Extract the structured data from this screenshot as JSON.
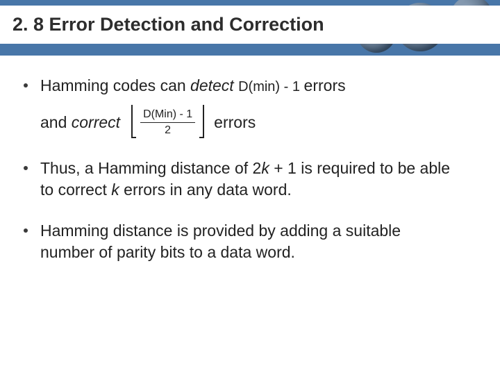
{
  "title": "2. 8 Error Detection and Correction",
  "bullets": {
    "b1": {
      "pre": "Hamming codes can ",
      "detect": "detect",
      "formula1": " D(min) - 1 ",
      "post1": "errors",
      "line2pre": "and ",
      "correct": "correct",
      "frac_num": "D(Min) - 1",
      "frac_den": "2",
      "line2post": " errors"
    },
    "b2": {
      "t1": "Thus, a Hamming distance of 2",
      "k1": "k",
      "t2": " + 1 is required to be able to correct ",
      "k2": "k",
      "t3": " errors in any data word."
    },
    "b3": "Hamming distance is provided by adding a suitable number of parity bits to a data word."
  }
}
